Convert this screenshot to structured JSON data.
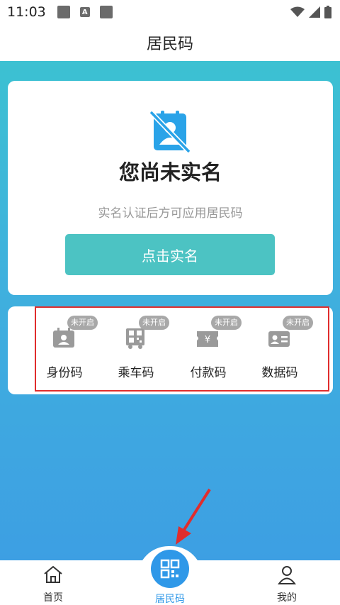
{
  "status_bar": {
    "time": "11:03",
    "notification_icons": [
      "square-icon",
      "a-icon",
      "square-icon"
    ],
    "right_icons": [
      "wifi-icon",
      "signal-icon",
      "battery-icon"
    ]
  },
  "header": {
    "title": "居民码"
  },
  "verify_card": {
    "title": "您尚未实名",
    "subtitle": "实名认证后方可应用居民码",
    "button_label": "点击实名",
    "icon": "no-user-icon"
  },
  "codes": {
    "items": [
      {
        "label": "身份码",
        "badge": "未开启",
        "icon": "id-card-icon"
      },
      {
        "label": "乘车码",
        "badge": "未开启",
        "icon": "bus-qr-icon"
      },
      {
        "label": "付款码",
        "badge": "未开启",
        "icon": "yuan-ticket-icon"
      },
      {
        "label": "数据码",
        "badge": "未开启",
        "icon": "data-card-icon"
      }
    ]
  },
  "tabbar": {
    "items": [
      {
        "label": "首页",
        "icon": "home-icon"
      },
      {
        "label": "居民码",
        "icon": "qr-code-icon",
        "active": true
      },
      {
        "label": "我的",
        "icon": "person-icon"
      }
    ]
  },
  "colors": {
    "accent": "#2f98e8",
    "button": "#4cc3c3",
    "badge": "#a8a8a8",
    "highlight_box": "#e02d2d",
    "gradient_top": "#3cc1d2",
    "gradient_bottom": "#3d9fe3"
  }
}
